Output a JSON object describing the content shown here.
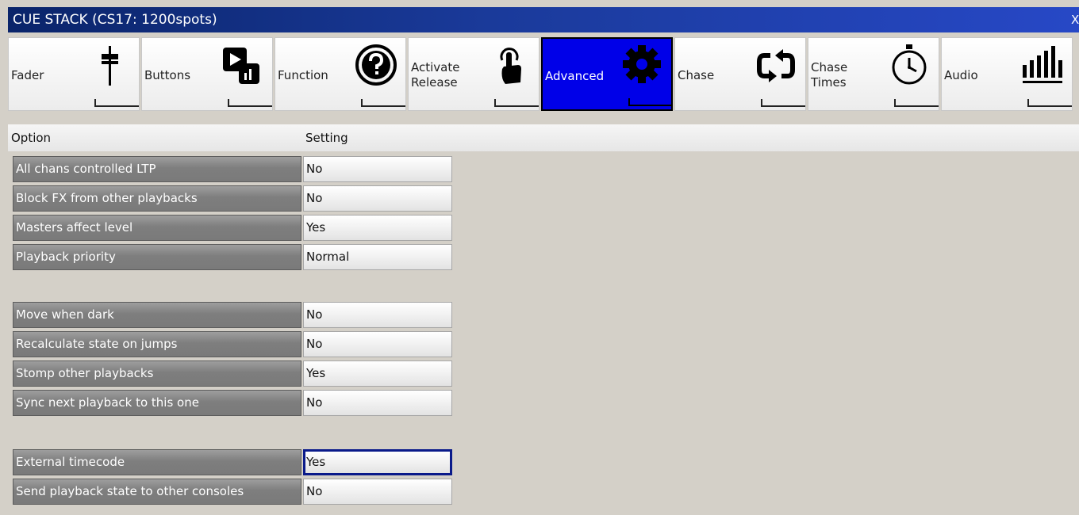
{
  "window": {
    "title": "CUE STACK (CS17: 1200spots)",
    "close_glyph": "X"
  },
  "tabs": [
    {
      "label": "Fader",
      "icon": "fader-icon"
    },
    {
      "label": "Buttons",
      "icon": "play-buttons-icon"
    },
    {
      "label": "Function",
      "icon": "help-circle-icon"
    },
    {
      "label": "Activate\nRelease",
      "icon": "touch-icon"
    },
    {
      "label": "Advanced",
      "icon": "gear-icon",
      "active": true
    },
    {
      "label": "Chase",
      "icon": "cycle-arrows-icon"
    },
    {
      "label": "Chase\nTimes",
      "icon": "stopwatch-icon"
    },
    {
      "label": "Audio",
      "icon": "audio-meter-icon"
    }
  ],
  "table": {
    "headers": {
      "option": "Option",
      "setting": "Setting"
    },
    "rows": [
      {
        "option": "All chans controlled LTP",
        "setting": "No"
      },
      {
        "option": "Block FX from other playbacks",
        "setting": "No"
      },
      {
        "option": "Masters affect level",
        "setting": "Yes"
      },
      {
        "option": "Playback priority",
        "setting": "Normal"
      },
      {
        "option": "Move when dark",
        "setting": "No"
      },
      {
        "option": "Recalculate state on jumps",
        "setting": "No"
      },
      {
        "option": "Stomp other playbacks",
        "setting": "Yes"
      },
      {
        "option": "Sync next playback to this one",
        "setting": "No"
      },
      {
        "option": "External timecode",
        "setting": "Yes",
        "selected": true
      },
      {
        "option": "Send playback state to other consoles",
        "setting": "No"
      }
    ]
  },
  "colors": {
    "title_bar": "#0a246a",
    "active_tab": "#0000e8",
    "background": "#d4d0c8",
    "option_cell": "#7e7e7e",
    "selection_border": "#0a1a8a"
  }
}
